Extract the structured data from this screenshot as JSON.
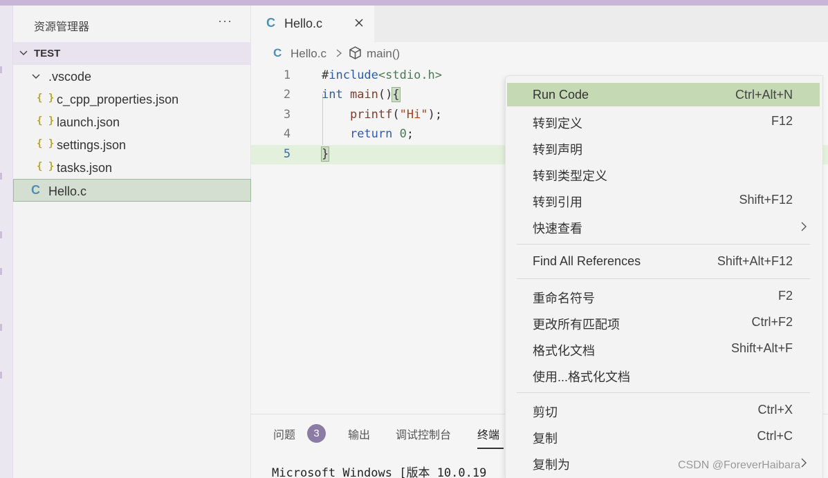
{
  "explorer": {
    "title": "资源管理器",
    "more": "···",
    "section": "TEST",
    "tree": [
      {
        "label": ".vscode",
        "kind": "folder",
        "icon": "chevron-down-icon"
      },
      {
        "label": "c_cpp_properties.json",
        "kind": "json",
        "icon_text": "{ }"
      },
      {
        "label": "launch.json",
        "kind": "json",
        "icon_text": "{ }"
      },
      {
        "label": "settings.json",
        "kind": "json",
        "icon_text": "{ }"
      },
      {
        "label": "tasks.json",
        "kind": "json",
        "icon_text": "{ }"
      },
      {
        "label": "Hello.c",
        "kind": "c-file",
        "icon_text": "C"
      }
    ]
  },
  "editor": {
    "tab": {
      "icon_text": "C",
      "label": "Hello.c"
    },
    "breadcrumb": {
      "icon_text": "C",
      "file": "Hello.c",
      "symbol": "main()"
    },
    "line_numbers": [
      "1",
      "2",
      "3",
      "4",
      "5"
    ],
    "code": [
      {
        "t1": "#",
        "t2": "include",
        "t3": "<stdio.h>"
      },
      {
        "t1": "int",
        "t2": " main",
        "t3": "()",
        "t4": "{"
      },
      {
        "t1": "    ",
        "t2": "printf",
        "t3": "(",
        "t4": "\"Hi\"",
        "t5": ");"
      },
      {
        "t1": "    ",
        "t2": "return",
        "t3": " ",
        "t4": "0",
        "t5": ";"
      },
      {
        "t1": "}"
      }
    ]
  },
  "panel": {
    "tabs": [
      "问题",
      "输出",
      "调试控制台",
      "终端"
    ],
    "problems_count": "3",
    "terminal_line": "Microsoft Windows [版本 10.0.19"
  },
  "context_menu": {
    "items": [
      {
        "label": "Run Code",
        "shortcut": "Ctrl+Alt+N"
      },
      {
        "label": "转到定义",
        "shortcut": "F12"
      },
      {
        "label": "转到声明",
        "shortcut": ""
      },
      {
        "label": "转到类型定义",
        "shortcut": ""
      },
      {
        "label": "转到引用",
        "shortcut": "Shift+F12"
      },
      {
        "label": "快速查看",
        "shortcut": ""
      },
      {
        "label": "Find All References",
        "shortcut": "Shift+Alt+F12"
      },
      {
        "label": "重命名符号",
        "shortcut": "F2"
      },
      {
        "label": "更改所有匹配项",
        "shortcut": "Ctrl+F2"
      },
      {
        "label": "格式化文档",
        "shortcut": "Shift+Alt+F"
      },
      {
        "label": "使用...格式化文档",
        "shortcut": ""
      },
      {
        "label": "剪切",
        "shortcut": "Ctrl+X"
      },
      {
        "label": "复制",
        "shortcut": "Ctrl+C"
      },
      {
        "label": "复制为",
        "shortcut": ""
      }
    ]
  },
  "watermark": "CSDN @ForeverHaibara",
  "colors": {
    "menu_highlight": "#c5d9b5",
    "selection": "#d5dfd1",
    "current_line": "#e3f1dc",
    "badge": "#8c7ba4",
    "c_icon": "#4f8fb3",
    "json_icon": "#b5a42c"
  }
}
